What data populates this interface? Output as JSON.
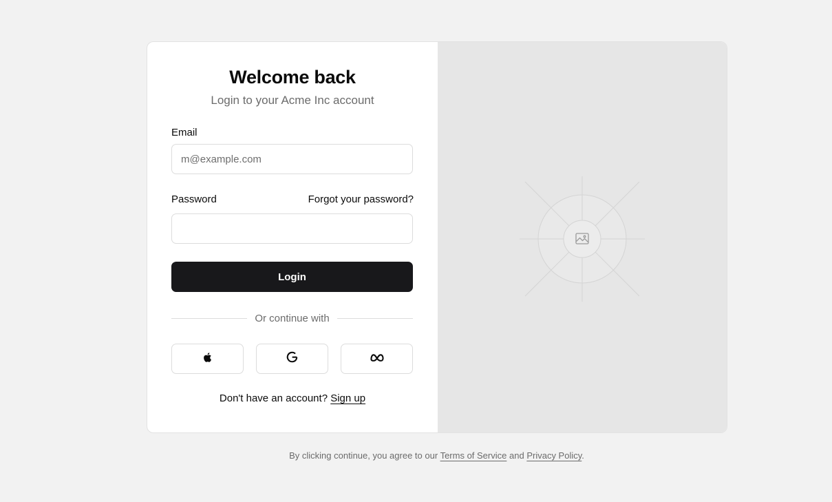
{
  "login": {
    "title": "Welcome back",
    "subtitle": "Login to your Acme Inc account",
    "email_label": "Email",
    "email_placeholder": "m@example.com",
    "email_value": "",
    "password_label": "Password",
    "forgot_link": "Forgot your password?",
    "password_value": "",
    "login_button": "Login",
    "divider_text": "Or continue with",
    "social": [
      {
        "icon": "apple-icon"
      },
      {
        "icon": "google-icon"
      },
      {
        "icon": "meta-icon"
      }
    ],
    "signup_prompt": "Don't have an account?",
    "signup_link": "Sign up"
  },
  "media": {
    "icon": "image-placeholder-icon"
  },
  "footer": {
    "prefix": "By clicking continue, you agree to our",
    "terms_link": "Terms of Service",
    "and": "and",
    "privacy_link": "Privacy Policy",
    "suffix": "."
  },
  "colors": {
    "background": "#f2f2f2",
    "card": "#ffffff",
    "media_pane": "#e6e6e6",
    "primary_button": "#18181b",
    "muted_text": "#6b6b6b",
    "border": "#dcdcdc"
  }
}
